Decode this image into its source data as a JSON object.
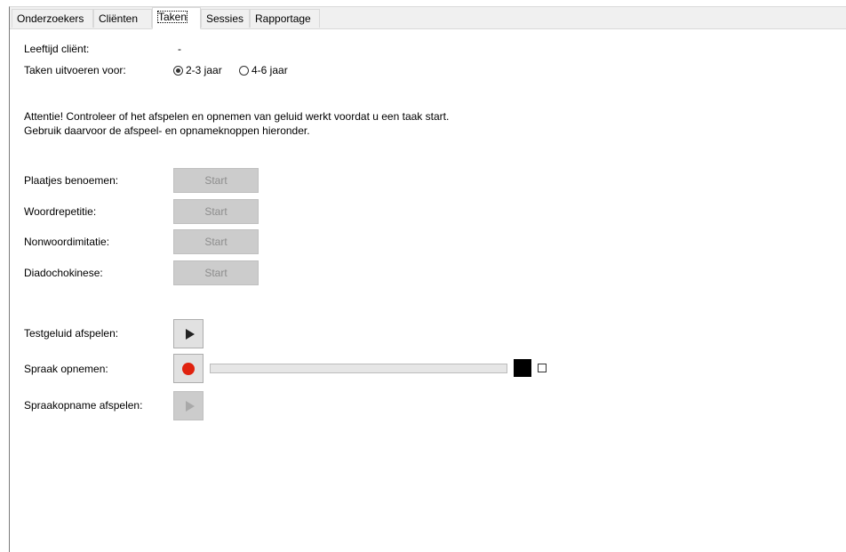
{
  "tabs": [
    {
      "label": "Onderzoekers",
      "active": false
    },
    {
      "label": "Cliënten",
      "active": false
    },
    {
      "label": "Taken",
      "active": true
    },
    {
      "label": "Sessies",
      "active": false
    },
    {
      "label": "Rapportage",
      "active": false
    }
  ],
  "client_age": {
    "label": "Leeftijd cliënt:",
    "value": "-"
  },
  "age_group": {
    "label": "Taken uitvoeren voor:",
    "options": [
      {
        "label": "2-3 jaar",
        "checked": true
      },
      {
        "label": "4-6 jaar",
        "checked": false
      }
    ]
  },
  "notice": {
    "line1": "Attentie! Controleer of het afspelen en opnemen van geluid werkt voordat u een taak start.",
    "line2": "Gebruik daarvoor de afspeel- en opnameknoppen hieronder."
  },
  "tasks": [
    {
      "label": "Plaatjes benoemen:",
      "button": "Start",
      "enabled": false
    },
    {
      "label": "Woordrepetitie:",
      "button": "Start",
      "enabled": false
    },
    {
      "label": "Nonwoordimitatie:",
      "button": "Start",
      "enabled": false
    },
    {
      "label": "Diadochokinese:",
      "button": "Start",
      "enabled": false
    }
  ],
  "audio": {
    "test_play": {
      "label": "Testgeluid afspelen:",
      "icon": "play-icon",
      "enabled": true
    },
    "record": {
      "label": "Spraak opnemen:",
      "icon": "record-icon",
      "enabled": true,
      "level": 0
    },
    "playback": {
      "label": "Spraakopname afspelen:",
      "icon": "play-icon",
      "enabled": false
    }
  },
  "colors": {
    "record": "#e0220f",
    "disabled_button": "#cccccc",
    "level_indicator": "#000000"
  }
}
